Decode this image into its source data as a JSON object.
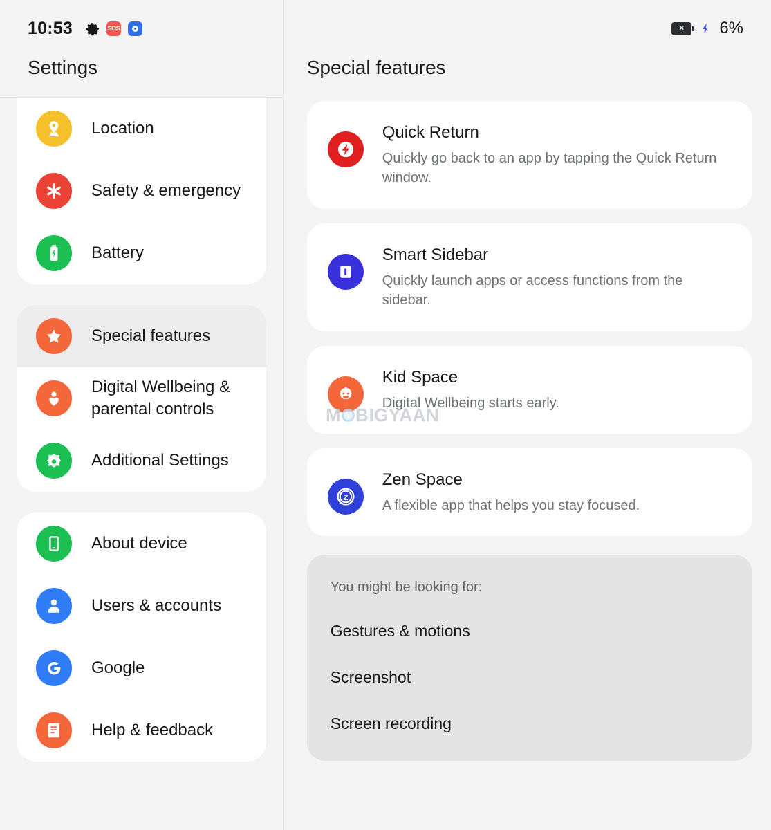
{
  "status_bar": {
    "time": "10:53",
    "left_icons": [
      {
        "name": "gear-icon",
        "label": "settings"
      },
      {
        "name": "sos-badge-icon",
        "label": "SOS"
      },
      {
        "name": "camera-badge-icon",
        "label": "camera"
      }
    ],
    "battery_icon": "battery-x-icon",
    "battery_x_glyph": "×",
    "charging_icon": "charging-bolt-icon",
    "battery_percent": "6%"
  },
  "sidebar": {
    "title": "Settings",
    "groups": [
      {
        "clipped": true,
        "items": [
          {
            "label": "Location",
            "icon": "location-pin-icon",
            "color": "#f5c02a",
            "selected": false
          },
          {
            "label": "Safety & emergency",
            "icon": "emergency-asterisk-icon",
            "color": "#ea4335",
            "selected": false
          },
          {
            "label": "Battery",
            "icon": "battery-bolt-icon",
            "color": "#1cbf52",
            "selected": false
          }
        ]
      },
      {
        "clipped": false,
        "items": [
          {
            "label": "Special features",
            "icon": "star-icon",
            "color": "#f4673a",
            "selected": true
          },
          {
            "label": "Digital Wellbeing & parental controls",
            "icon": "wellbeing-person-heart-icon",
            "color": "#f4673a",
            "selected": false
          },
          {
            "label": "Additional Settings",
            "icon": "settings-gear-icon",
            "color": "#1cbf52",
            "selected": false
          }
        ]
      },
      {
        "clipped": false,
        "items": [
          {
            "label": "About device",
            "icon": "phone-icon",
            "color": "#1cbf52",
            "selected": false
          },
          {
            "label": "Users & accounts",
            "icon": "person-icon",
            "color": "#2f7cf6",
            "selected": false
          },
          {
            "label": "Google",
            "icon": "google-g-icon",
            "color": "#2f7cf6",
            "selected": false
          },
          {
            "label": "Help & feedback",
            "icon": "help-book-icon",
            "color": "#f4673a",
            "selected": false
          }
        ]
      }
    ]
  },
  "main": {
    "title": "Special features",
    "cards": [
      {
        "title": "Quick Return",
        "desc": "Quickly go back to an app by tapping the Quick Return window.",
        "icon": "quick-return-bolt-icon",
        "color": "#e02020"
      },
      {
        "title": "Smart Sidebar",
        "desc": "Quickly launch apps or access functions from the sidebar.",
        "icon": "smart-sidebar-icon",
        "color": "#3730db"
      },
      {
        "title": "Kid Space",
        "desc": "Digital Wellbeing starts early.",
        "icon": "kid-face-icon",
        "color": "#f4673a"
      },
      {
        "title": "Zen Space",
        "desc": "A flexible app that helps you stay focused.",
        "icon": "zen-space-icon",
        "color": "#2f41d8"
      }
    ],
    "looking_for": {
      "heading": "You might be looking for:",
      "items": [
        "Gestures & motions",
        "Screenshot",
        "Screen recording"
      ]
    }
  },
  "watermark": {
    "part1": "M",
    "part2": "BIGYAAN"
  }
}
